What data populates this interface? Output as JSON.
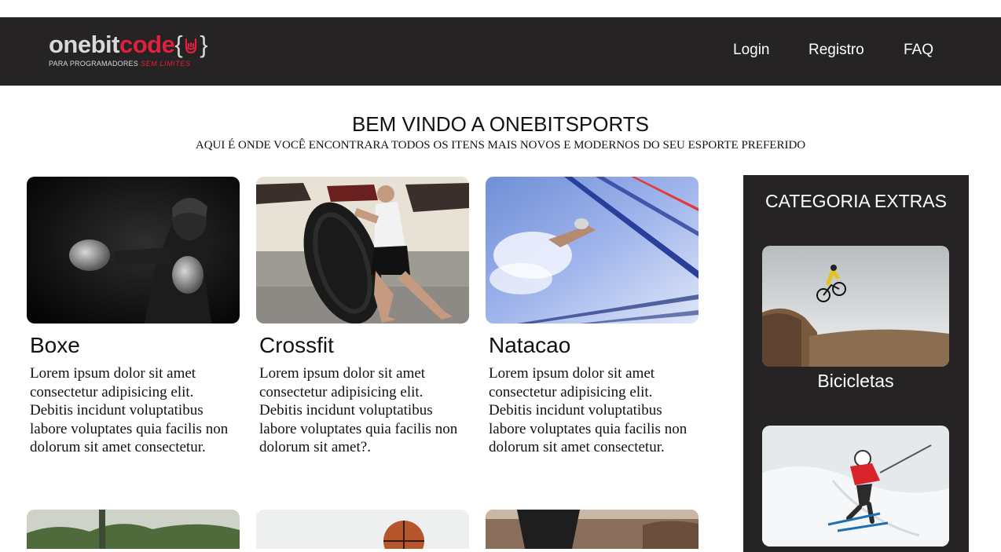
{
  "brand": {
    "logo_one": "onebit",
    "logo_code": "code",
    "logo_open": "{",
    "logo_close": "}",
    "tagline_a": "PARA PROGRAMADORES",
    "tagline_b": "SEM LIMITES"
  },
  "nav": {
    "login": "Login",
    "registro": "Registro",
    "faq": "FAQ"
  },
  "hero": {
    "title": "BEM VINDO A ONEBITSPORTS",
    "subtitle": "AQUI É ONDE VOCÊ ENCONTRARA TODOS OS ITENS MAIS NOVOS E MODERNOS DO SEU ESPORTE PREFERIDO"
  },
  "cards": [
    {
      "title": "Boxe",
      "text": "Lorem ipsum dolor sit amet consectetur adipisicing elit. Debitis incidunt voluptatibus labore voluptates quia facilis non dolorum sit amet consectetur."
    },
    {
      "title": "Crossfit",
      "text": "Lorem ipsum dolor sit amet consectetur adipisicing elit. Debitis incidunt voluptatibus labore voluptates quia facilis non dolorum sit amet?."
    },
    {
      "title": "Natacao",
      "text": "Lorem ipsum dolor sit amet consectetur adipisicing elit. Debitis incidunt voluptatibus labore voluptates quia facilis non dolorum sit amet consectetur."
    }
  ],
  "sidebar": {
    "title": "CATEGORIA EXTRAS",
    "items": [
      {
        "label": "Bicicletas"
      }
    ]
  },
  "colors": {
    "navbar": "#252324",
    "brand_red": "#e0203e",
    "text_dark": "#111111"
  }
}
